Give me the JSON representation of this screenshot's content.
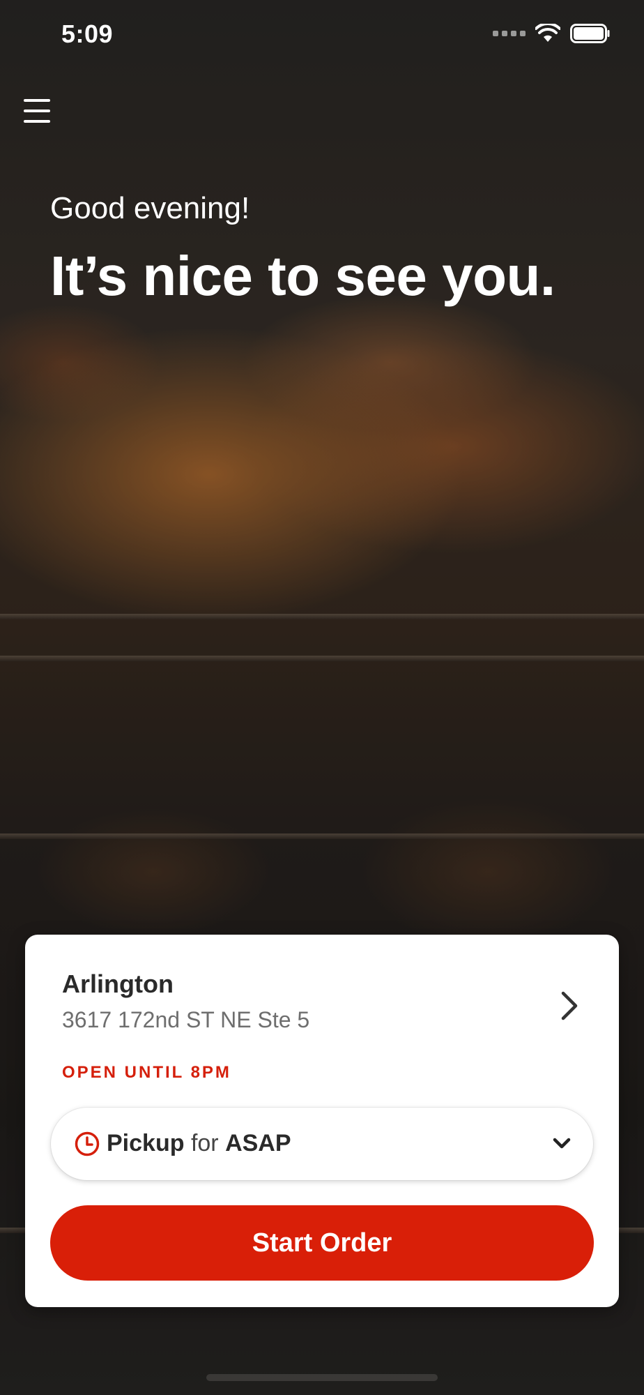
{
  "status_bar": {
    "time": "5:09"
  },
  "greeting": "Good evening!",
  "headline": "It’s nice to see you.",
  "location": {
    "name": "Arlington",
    "address": "3617 172nd ST NE Ste 5",
    "hours": "OPEN UNTIL 8PM"
  },
  "order_mode": {
    "method": "Pickup",
    "connector": "for",
    "time": "ASAP"
  },
  "start_button": "Start Order",
  "colors": {
    "accent": "#d91f08",
    "hours_text": "#d51f0b"
  },
  "icons": [
    "menu-icon",
    "chevron-right-icon",
    "clock-icon",
    "chevron-down-icon",
    "wifi-icon",
    "battery-icon",
    "signal-icon"
  ]
}
